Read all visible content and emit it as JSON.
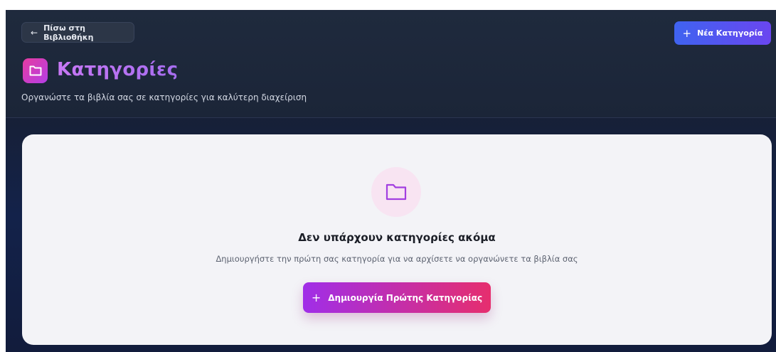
{
  "header": {
    "back_label": "Πίσω στη Βιβλιοθήκη",
    "back_icon": "arrow-left-icon",
    "new_category_label": "Νέα Κατηγορία",
    "new_category_icon": "plus-icon",
    "title": "Κατηγορίες",
    "title_icon": "folder-icon",
    "subtitle": "Οργανώστε τα βιβλία σας σε κατηγορίες για καλύτερη διαχείριση"
  },
  "empty_state": {
    "icon": "folder-icon",
    "title": "Δεν υπάρχουν κατηγορίες ακόμα",
    "description": "Δημιουργήστε την πρώτη σας κατηγορία για να αρχίσετε να οργανώνετε τα βιβλία σας",
    "button_label": "Δημιουργία Πρώτης Κατηγορίας",
    "button_icon": "plus-icon"
  },
  "colors": {
    "accent_blue": "#3f63f0",
    "accent_purple": "#a02ee8",
    "accent_pink": "#e62e6e",
    "title_gradient": "#c878f5"
  }
}
